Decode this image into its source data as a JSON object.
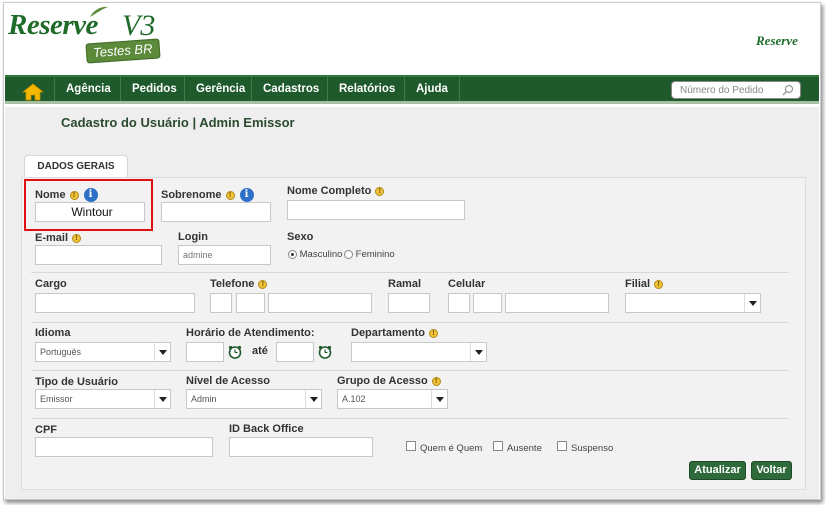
{
  "header": {
    "logo_text": "Reserve",
    "logo_version": "V3",
    "logo_badge": "Testes BR",
    "brand_right": "Reserve"
  },
  "nav": {
    "items": [
      "Agência",
      "Pedidos",
      "Gerência",
      "Cadastros",
      "Relatórios",
      "Ajuda"
    ],
    "search_placeholder": "Número do Pedido"
  },
  "page": {
    "title": "Cadastro do Usuário | Admin Emissor",
    "tab": "DADOS GERAIS"
  },
  "form": {
    "nome_label": "Nome",
    "nome_value": "Wintour",
    "sobrenome_label": "Sobrenome",
    "nome_completo_label": "Nome Completo",
    "email_label": "E-mail",
    "login_label": "Login",
    "login_value": "admine",
    "sexo_label": "Sexo",
    "sexo_options": [
      "Masculino",
      "Feminino"
    ],
    "cargo_label": "Cargo",
    "telefone_label": "Telefone",
    "ramal_label": "Ramal",
    "celular_label": "Celular",
    "filial_label": "Filial",
    "idioma_label": "Idioma",
    "idioma_value": "Português",
    "horario_label": "Horário de Atendimento:",
    "ate_label": "até",
    "departamento_label": "Departamento",
    "tipo_usuario_label": "Tipo de Usuário",
    "tipo_usuario_value": "Emissor",
    "nivel_acesso_label": "Nível de Acesso",
    "nivel_acesso_value": "Admin",
    "grupo_acesso_label": "Grupo de Acesso",
    "grupo_acesso_value": "A.102",
    "cpf_label": "CPF",
    "id_back_office_label": "ID Back Office",
    "checkboxes": [
      "Quem é Quem",
      "Ausente",
      "Suspenso"
    ]
  },
  "buttons": {
    "atualizar": "Atualizar",
    "voltar": "Voltar"
  },
  "colors": {
    "nav_bg": "#1e5a2b",
    "brand_green": "#1f6b2a",
    "highlight": "#e01010"
  }
}
